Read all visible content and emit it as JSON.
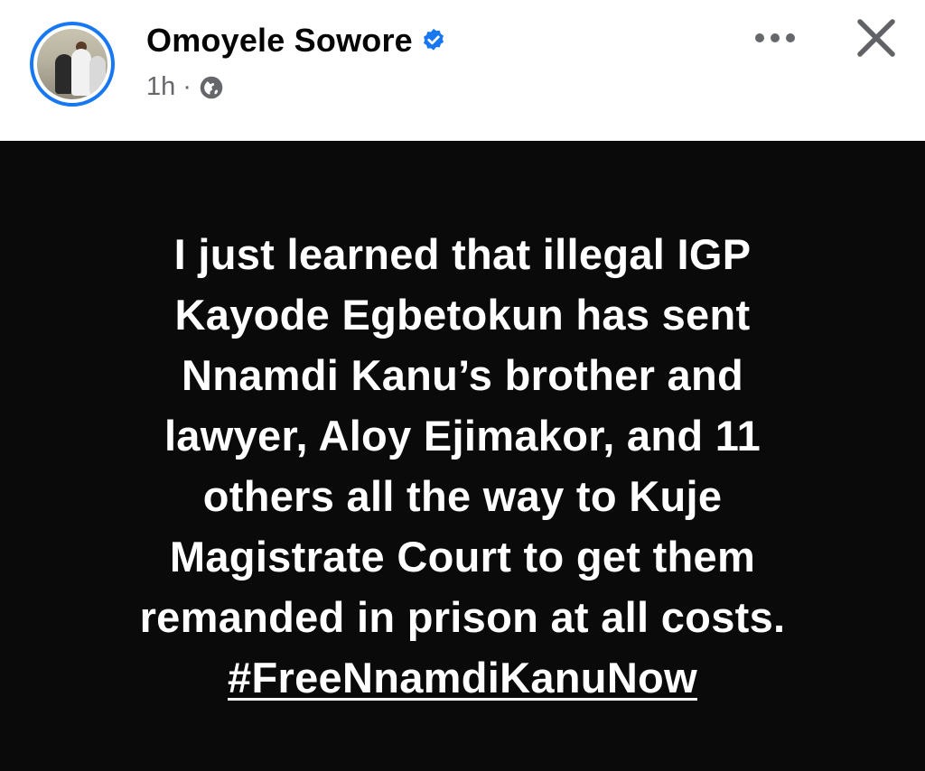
{
  "post": {
    "author": {
      "name": "Omoyele Sowore",
      "verified": true,
      "avatar_icon": "profile-photo"
    },
    "time": "1h",
    "separator": "·",
    "audience_icon": "globe-icon",
    "content_lines": [
      "I just learned that illegal IGP",
      "Kayode Egbetokun has sent",
      "Nnamdi Kanu’s brother and",
      "lawyer, Aloy Ejimakor, and 11",
      "others all the way to Kuje",
      "Magistrate Court to get them",
      "remanded in prison at all costs."
    ],
    "hashtag": "#FreeNnamdiKanuNow",
    "background_color": "#0a0a0a",
    "text_color": "#ffffff"
  },
  "header": {
    "more_icon": "more-options-icon",
    "close_icon": "close-icon"
  },
  "colors": {
    "accent": "#1877f2",
    "meta_text": "#65676b"
  }
}
